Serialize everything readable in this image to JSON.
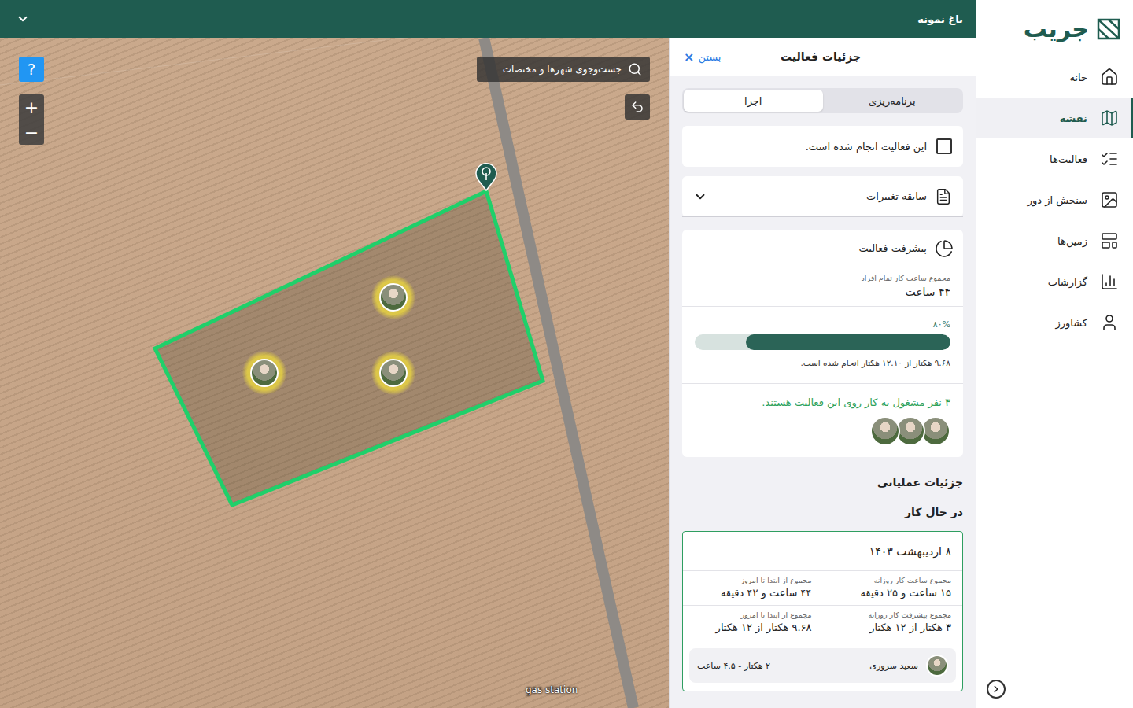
{
  "app": {
    "logo": "جریب",
    "farm": "باغ نمونه"
  },
  "sidebar": {
    "items": [
      {
        "label": "خانه",
        "selected": false
      },
      {
        "label": "نقشه",
        "selected": true
      },
      {
        "label": "فعالیت‌ها",
        "selected": false
      },
      {
        "label": "سنجش از دور",
        "selected": false
      },
      {
        "label": "زمین‌ها",
        "selected": false
      },
      {
        "label": "گزارشات",
        "selected": false
      },
      {
        "label": "کشاورز",
        "selected": false
      }
    ]
  },
  "map": {
    "search_placeholder": "جست‌وجوی شهرها و مختصات",
    "help": "?",
    "zoom_in": "+",
    "zoom_out": "−",
    "label": "gas station",
    "pins": [
      {
        "kind": "tree"
      },
      {
        "kind": "worker"
      },
      {
        "kind": "worker"
      },
      {
        "kind": "worker"
      }
    ]
  },
  "panel": {
    "title": "جزئیات فعالیت",
    "close": "بستن",
    "close_icon": "×",
    "tabs": [
      {
        "label": "برنامه‌ریزی",
        "selected": false
      },
      {
        "label": "اجرا",
        "selected": true
      }
    ],
    "done": {
      "label": "این فعالیت انجام شده است.",
      "checked": false
    },
    "history": {
      "label": "سابقه تغییرات",
      "expanded": false
    },
    "progress": {
      "title": "پیشرفت فعالیت",
      "hours_label": "مجموع ساعت کار تمام افراد",
      "hours": "۴۴ ساعت",
      "percent": "۸۰%",
      "level": 0.8,
      "area_text": "۹.۶۸ هکتار از ۱۲.۱۰ هکتار انجام شده است.",
      "workers_text": "۳ نفر مشغول به کار روی این فعالیت هستند.",
      "avatars": [
        {
          "kind": "worker"
        },
        {
          "kind": "worker"
        },
        {
          "kind": "worker"
        }
      ]
    },
    "operations": {
      "title": "جزئیات عملیاتی",
      "status": "در حال کار",
      "day": {
        "date": "۸ اردیبهشت ۱۴۰۳",
        "stats": [
          {
            "label": "مجموع ساعت کار روزانه",
            "value": "۱۵ ساعت و ۲۵ دقیقه"
          },
          {
            "label": "مجموع از ابتدا تا امروز",
            "value": "۴۴ ساعت و ۴۲ دقیقه"
          },
          {
            "label": "مجموع پیشرفت کار روزانه",
            "value": "۳ هکتار از ۱۲ هکتار"
          },
          {
            "label": "مجموع از ابتدا تا امروز",
            "value": "۹.۶۸ هکتار از ۱۲ هکتار"
          }
        ],
        "workers": [
          {
            "name": "سعید سروری",
            "summary": "۲ هکتار - ۴.۵ ساعت"
          }
        ]
      }
    }
  }
}
